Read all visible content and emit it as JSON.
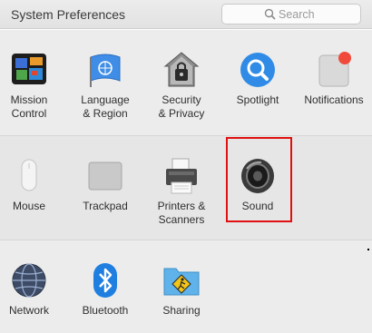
{
  "window": {
    "title": "System Preferences"
  },
  "search": {
    "placeholder": "Search",
    "icon": "magnifier"
  },
  "sections": [
    {
      "items": [
        {
          "label": "Mission\nControl",
          "icon": "mission-control"
        },
        {
          "label": "Language\n& Region",
          "icon": "language-flag"
        },
        {
          "label": "Security\n& Privacy",
          "icon": "security-house"
        },
        {
          "label": "Spotlight",
          "icon": "spotlight-magnifier"
        },
        {
          "label": "Notifications",
          "icon": "notifications"
        }
      ]
    },
    {
      "items": [
        {
          "label": "Mouse",
          "icon": "mouse"
        },
        {
          "label": "Trackpad",
          "icon": "trackpad"
        },
        {
          "label": "Printers &\nScanners",
          "icon": "printer"
        },
        {
          "label": "Sound",
          "icon": "speaker",
          "highlighted": true
        }
      ]
    },
    {
      "items": [
        {
          "label": "Network",
          "icon": "network-globe"
        },
        {
          "label": "Bluetooth",
          "icon": "bluetooth"
        },
        {
          "label": "Sharing",
          "icon": "sharing-folder"
        }
      ]
    }
  ],
  "colors": {
    "highlight": "#e01010",
    "accent": "#1f7fe0"
  }
}
